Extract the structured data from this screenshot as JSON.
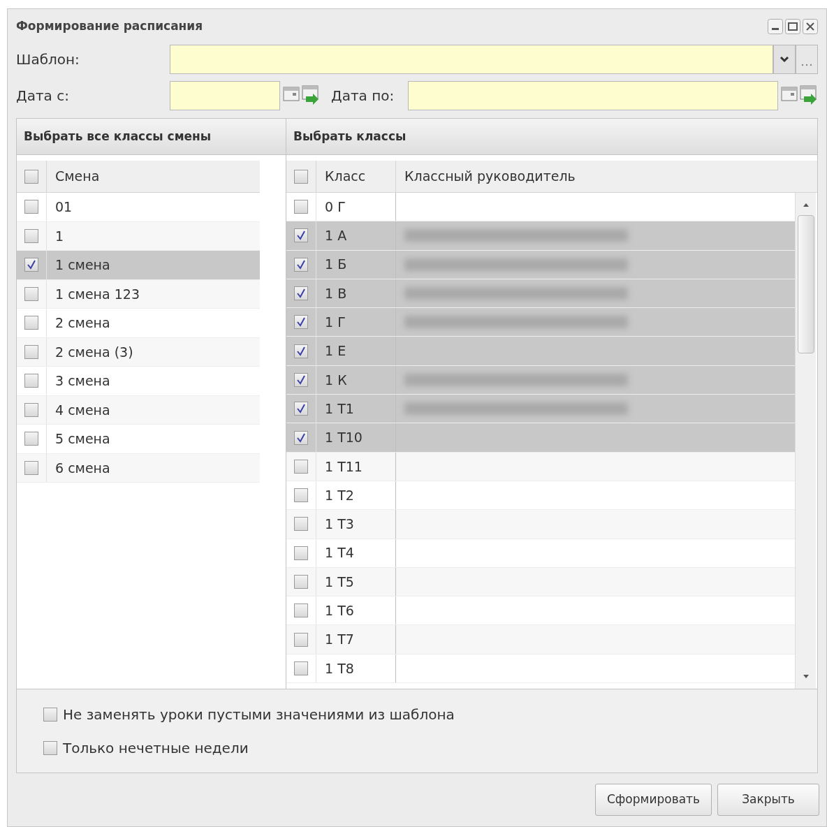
{
  "window": {
    "title": "Формирование расписания"
  },
  "form": {
    "template_label": "Шаблон:",
    "date_from_label": "Дата с:",
    "date_to_label": "Дата по:"
  },
  "shifts_panel": {
    "title": "Выбрать все классы смены",
    "header_checked": false,
    "column": "Смена",
    "rows": [
      {
        "name": "01",
        "checked": false,
        "selected": false
      },
      {
        "name": "1",
        "checked": false,
        "selected": false
      },
      {
        "name": "1 смена",
        "checked": true,
        "selected": true
      },
      {
        "name": "1 смена 123",
        "checked": false,
        "selected": false
      },
      {
        "name": "2 смена",
        "checked": false,
        "selected": false
      },
      {
        "name": "2 смена (3)",
        "checked": false,
        "selected": false
      },
      {
        "name": "3 смена",
        "checked": false,
        "selected": false
      },
      {
        "name": "4 смена",
        "checked": false,
        "selected": false
      },
      {
        "name": "5 смена",
        "checked": false,
        "selected": false
      },
      {
        "name": "6 смена",
        "checked": false,
        "selected": false
      }
    ]
  },
  "classes_panel": {
    "title": "Выбрать классы",
    "header_checked": false,
    "columns": [
      "Класс",
      "Классный руководитель"
    ],
    "rows": [
      {
        "name": "0 Г",
        "checked": false,
        "selected": false,
        "teacher_blurred": false
      },
      {
        "name": "1 А",
        "checked": true,
        "selected": true,
        "teacher_blurred": true
      },
      {
        "name": "1 Б",
        "checked": true,
        "selected": true,
        "teacher_blurred": true
      },
      {
        "name": "1 В",
        "checked": true,
        "selected": true,
        "teacher_blurred": true
      },
      {
        "name": "1 Г",
        "checked": true,
        "selected": true,
        "teacher_blurred": true
      },
      {
        "name": "1 Е",
        "checked": true,
        "selected": true,
        "teacher_blurred": false
      },
      {
        "name": "1 К",
        "checked": true,
        "selected": true,
        "teacher_blurred": true
      },
      {
        "name": "1 Т1",
        "checked": true,
        "selected": true,
        "teacher_blurred": true
      },
      {
        "name": "1 Т10",
        "checked": true,
        "selected": true,
        "teacher_blurred": false
      },
      {
        "name": "1 Т11",
        "checked": false,
        "selected": false,
        "teacher_blurred": false
      },
      {
        "name": "1 Т2",
        "checked": false,
        "selected": false,
        "teacher_blurred": false
      },
      {
        "name": "1 Т3",
        "checked": false,
        "selected": false,
        "teacher_blurred": false
      },
      {
        "name": "1 Т4",
        "checked": false,
        "selected": false,
        "teacher_blurred": false
      },
      {
        "name": "1 Т5",
        "checked": false,
        "selected": false,
        "teacher_blurred": false
      },
      {
        "name": "1 Т6",
        "checked": false,
        "selected": false,
        "teacher_blurred": false
      },
      {
        "name": "1 Т7",
        "checked": false,
        "selected": false,
        "teacher_blurred": false
      },
      {
        "name": "1 Т8",
        "checked": false,
        "selected": false,
        "teacher_blurred": false
      }
    ]
  },
  "options": [
    {
      "label": "Не заменять уроки пустыми значениями из шаблона",
      "checked": false
    },
    {
      "label": "Только нечетные недели",
      "checked": false
    }
  ],
  "buttons": [
    "Сформировать",
    "Закрыть"
  ]
}
